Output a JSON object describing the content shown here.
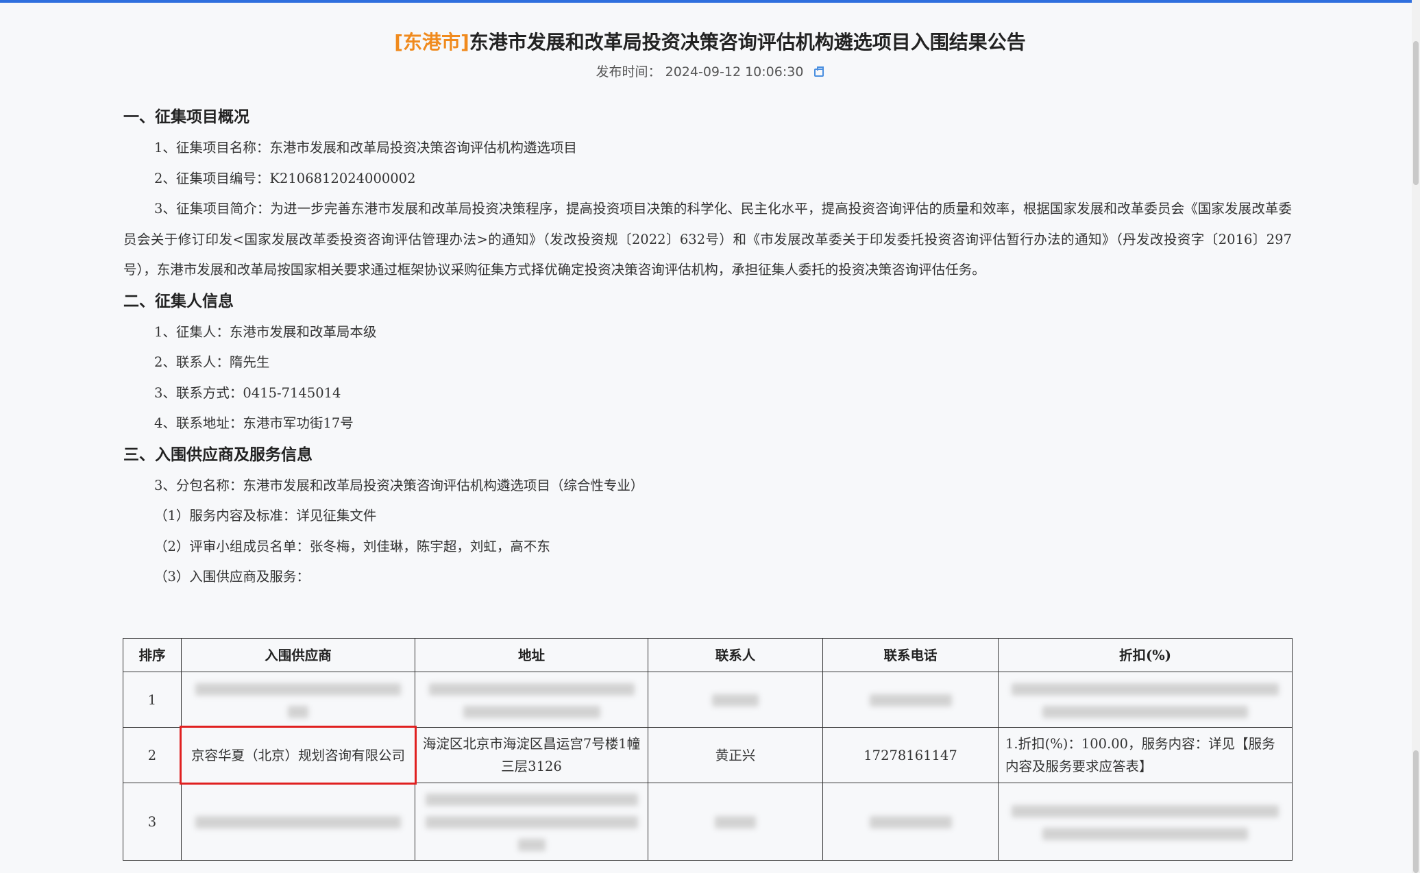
{
  "header": {
    "city_tag": "[东港市]",
    "title": "东港市发展和改革局投资决策咨询评估机构遴选项目入围结果公告",
    "publish_label": "发布时间：",
    "publish_time": "2024-09-12 10:06:30",
    "print_icon": "print-icon"
  },
  "sections": {
    "s1": {
      "heading": "一、征集项目概况",
      "item1": "1、征集项目名称：东港市发展和改革局投资决策咨询评估机构遴选项目",
      "item2": "2、征集项目编号：K2106812024000002",
      "item3": "3、征集项目简介：为进一步完善东港市发展和改革局投资决策程序，提高投资项目决策的科学化、民主化水平，提高投资咨询评估的质量和效率，根据国家发展和改革委员会《国家发展改革委员会关于修订印发<国家发展改革委投资咨询评估管理办法>的通知》（发改投资规〔2022〕632号）和《市发展改革委关于印发委托投资咨询评估暂行办法的通知》（丹发改投资字〔2016〕297号），东港市发展和改革局按国家相关要求通过框架协议采购征集方式择优确定投资决策咨询评估机构，承担征集人委托的投资决策咨询评估任务。"
    },
    "s2": {
      "heading": "二、征集人信息",
      "item1": "1、征集人：东港市发展和改革局本级",
      "item2": "2、联系人：隋先生",
      "item3": "3、联系方式：0415-7145014",
      "item4": "4、联系地址：东港市军功街17号"
    },
    "s3": {
      "heading": "三、入围供应商及服务信息",
      "item1": "3、分包名称：东港市发展和改革局投资决策咨询评估机构遴选项目（综合性专业）",
      "item2": "（1）服务内容及标准：详见征集文件",
      "item3": "（2）评审小组成员名单：张冬梅，刘佳琳，陈宇超，刘虹，高不东",
      "item4": "（3）入围供应商及服务："
    }
  },
  "table": {
    "headers": [
      "排序",
      "入围供应商",
      "地址",
      "联系人",
      "联系电话",
      "折扣(%)"
    ],
    "rows": [
      {
        "rank": "1"
      },
      {
        "rank": "2",
        "supplier": "京容华夏（北京）规划咨询有限公司",
        "address": "海淀区北京市海淀区昌运宫7号楼1幢三层3126",
        "contact": "黄正兴",
        "phone": "17278161147",
        "discount": "1.折扣(%)：100.00，服务内容：详见【服务内容及服务要求应答表】"
      },
      {
        "rank": "3"
      }
    ]
  }
}
